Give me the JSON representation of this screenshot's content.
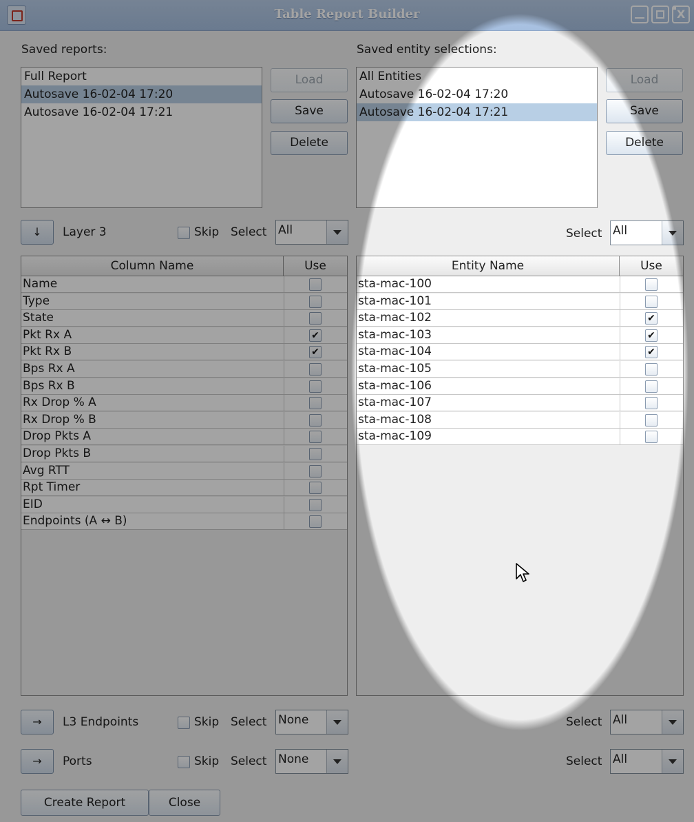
{
  "window": {
    "title": "Table Report Builder"
  },
  "left": {
    "saved_reports_label": "Saved reports:",
    "saved_reports": [
      {
        "label": "Full Report",
        "selected": false
      },
      {
        "label": "Autosave 16-02-04 17:20",
        "selected": true
      },
      {
        "label": "Autosave 16-02-04 17:21",
        "selected": false
      }
    ],
    "load": "Load",
    "save": "Save",
    "delete": "Delete",
    "layer_arrow": "↓",
    "layer_label": "Layer 3",
    "skip": "Skip",
    "select": "Select",
    "select_value": "All",
    "columns_header": [
      "Column Name",
      "Use"
    ],
    "columns": [
      {
        "name": "Name",
        "use": false
      },
      {
        "name": "Type",
        "use": false
      },
      {
        "name": "State",
        "use": false
      },
      {
        "name": "Pkt Rx A",
        "use": true
      },
      {
        "name": "Pkt Rx B",
        "use": true
      },
      {
        "name": "Bps Rx A",
        "use": false
      },
      {
        "name": "Bps Rx B",
        "use": false
      },
      {
        "name": "Rx Drop % A",
        "use": false
      },
      {
        "name": "Rx Drop % B",
        "use": false
      },
      {
        "name": "Drop Pkts A",
        "use": false
      },
      {
        "name": "Drop Pkts B",
        "use": false
      },
      {
        "name": "Avg RTT",
        "use": false
      },
      {
        "name": "Rpt Timer",
        "use": false
      },
      {
        "name": "EID",
        "use": false
      },
      {
        "name": "Endpoints (A ↔ B)",
        "use": false
      }
    ],
    "l3_arrow": "→",
    "l3_label": "L3 Endpoints",
    "l3_select_value": "None",
    "ports_arrow": "→",
    "ports_label": "Ports",
    "ports_select_value": "None",
    "create_report": "Create Report",
    "close": "Close"
  },
  "right": {
    "saved_selections_label": "Saved entity selections:",
    "saved_selections": [
      {
        "label": "All Entities",
        "selected": false
      },
      {
        "label": "Autosave 16-02-04 17:20",
        "selected": false
      },
      {
        "label": "Autosave 16-02-04 17:21",
        "selected": true
      }
    ],
    "load": "Load",
    "save": "Save",
    "delete": "Delete",
    "select": "Select",
    "select_value": "All",
    "entities_header": [
      "Entity Name",
      "Use"
    ],
    "entities": [
      {
        "name": "sta-mac-100",
        "use": false
      },
      {
        "name": "sta-mac-101",
        "use": false
      },
      {
        "name": "sta-mac-102",
        "use": true
      },
      {
        "name": "sta-mac-103",
        "use": true
      },
      {
        "name": "sta-mac-104",
        "use": true
      },
      {
        "name": "sta-mac-105",
        "use": false
      },
      {
        "name": "sta-mac-106",
        "use": false
      },
      {
        "name": "sta-mac-107",
        "use": false
      },
      {
        "name": "sta-mac-108",
        "use": false
      },
      {
        "name": "sta-mac-109",
        "use": false
      }
    ],
    "l3_select_value": "All",
    "ports_select_value": "All"
  },
  "check_glyph": "✔",
  "close_glyph": "X"
}
